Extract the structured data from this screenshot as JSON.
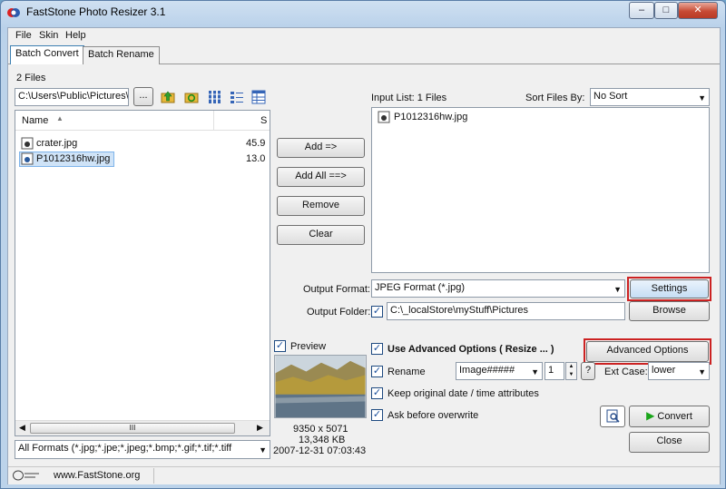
{
  "window": {
    "title": "FastStone Photo Resizer 3.1"
  },
  "menu": {
    "file": "File",
    "skin": "Skin",
    "help": "Help"
  },
  "tabs": {
    "batch_convert": "Batch Convert",
    "batch_rename": "Batch Rename"
  },
  "browser": {
    "file_count": "2 Files",
    "path": "C:\\Users\\Public\\Pictures\\S",
    "browse_btn": "...",
    "col_name": "Name",
    "col_size": "S",
    "files": [
      {
        "name": "crater.jpg",
        "size": "45.9"
      },
      {
        "name": "P1012316hw.jpg",
        "size": "13.0"
      }
    ],
    "scroll_mark": "III",
    "format_filter": "All Formats (*.jpg;*.jpe;*.jpeg;*.bmp;*.gif;*.tif;*.tiff"
  },
  "actions": {
    "add": "Add =>",
    "add_all": "Add All ==>",
    "remove": "Remove",
    "clear": "Clear"
  },
  "input_list": {
    "label": "Input List:  1 Files",
    "sort_label": "Sort Files By:",
    "sort_value": "No Sort",
    "items": [
      "P1012316hw.jpg"
    ]
  },
  "output": {
    "format_label": "Output Format:",
    "format_value": "JPEG Format (*.jpg)",
    "settings_btn": "Settings",
    "folder_label": "Output Folder:",
    "folder_value": "C:\\_localStore\\myStuff\\Pictures",
    "browse_btn": "Browse"
  },
  "preview": {
    "label": "Preview",
    "dimensions": "9350 x 5071",
    "filesize": "13,348 KB",
    "datetime": "2007-12-31 07:03:43"
  },
  "options": {
    "use_advanced": "Use Advanced Options ( Resize ... )",
    "advanced_btn": "Advanced Options",
    "rename": "Rename",
    "rename_pattern": "Image#####",
    "rename_start": "1",
    "help_btn": "?",
    "ext_case_label": "Ext Case:",
    "ext_case_value": "lower",
    "keep_date": "Keep original date / time attributes",
    "ask_overwrite": "Ask before overwrite"
  },
  "buttons": {
    "convert": "Convert",
    "close": "Close"
  },
  "status": {
    "website": "www.FastStone.org"
  },
  "colors": {
    "highlight": "#cc2222",
    "convert_green": "#1aa51a",
    "selection": "#cfe3f7"
  }
}
